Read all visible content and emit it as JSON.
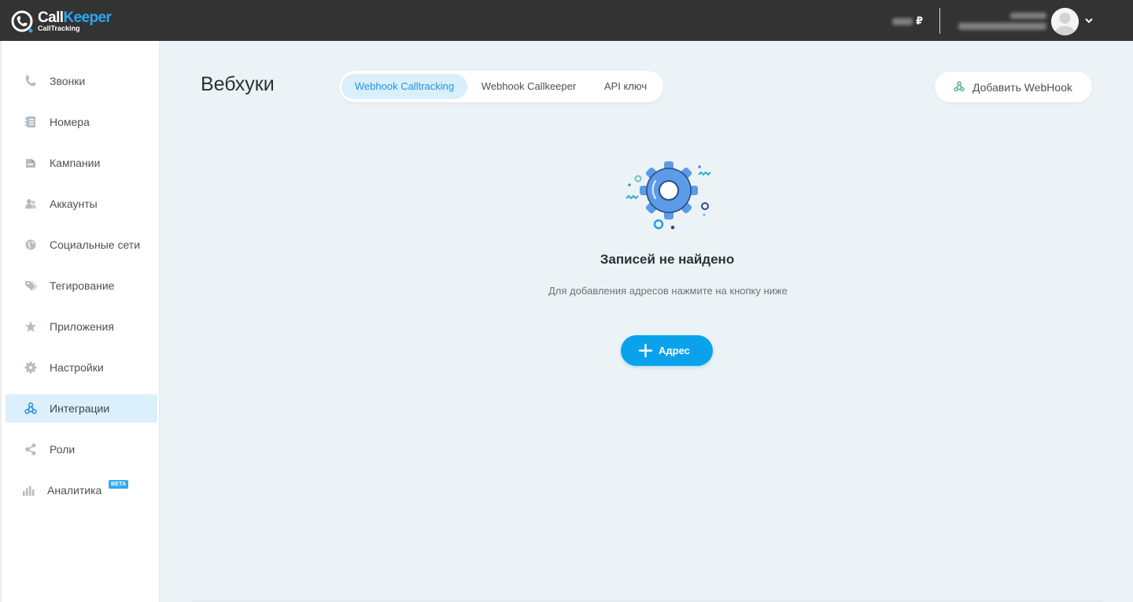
{
  "header": {
    "logo": {
      "brand_call": "Call",
      "brand_keeper": "Keeper",
      "sub": "CallTracking"
    },
    "balance_currency": "₽",
    "colors": {
      "bar_bg": "#333333",
      "brand_blue": "#2aa8f2"
    }
  },
  "sidebar": {
    "items": [
      {
        "label": "Звонки",
        "icon": "phone-icon"
      },
      {
        "label": "Номера",
        "icon": "numbers-icon"
      },
      {
        "label": "Кампании",
        "icon": "campaigns-icon"
      },
      {
        "label": "Аккаунты",
        "icon": "accounts-icon"
      },
      {
        "label": "Социальные сети",
        "icon": "globe-icon"
      },
      {
        "label": "Тегирование",
        "icon": "tag-icon"
      },
      {
        "label": "Приложения",
        "icon": "star-icon"
      },
      {
        "label": "Настройки",
        "icon": "gear-icon"
      },
      {
        "label": "Интеграции",
        "icon": "webhook-icon",
        "active": true
      },
      {
        "label": "Роли",
        "icon": "share-icon"
      },
      {
        "label": "Аналитика",
        "icon": "bar-chart-icon",
        "badge": "BETA"
      }
    ]
  },
  "main": {
    "title": "Вебхуки",
    "tabs": [
      {
        "label": "Webhook Calltracking",
        "active": true
      },
      {
        "label": "Webhook Callkeeper"
      },
      {
        "label": "API ключ"
      }
    ],
    "add_webhook_label": "Добавить WebHook",
    "empty": {
      "title": "Записей не найдено",
      "description": "Для добавления адресов нажмите на кнопку ниже",
      "button_label": "Адрес"
    },
    "colors": {
      "bg": "#ecf3f6",
      "accent": "#0ba2ec",
      "active_tab_bg": "#d9effb"
    }
  }
}
